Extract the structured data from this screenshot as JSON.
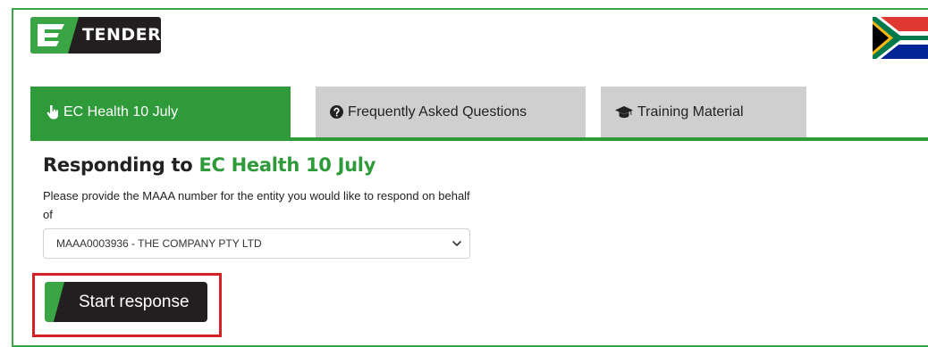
{
  "logo": {
    "text": "TENDER"
  },
  "tabs": [
    {
      "label": "EC Health 10 July",
      "icon": "hand-pointer-icon",
      "active": true
    },
    {
      "label": "Frequently Asked Questions",
      "icon": "question-circle-icon",
      "active": false
    },
    {
      "label": "Training Material",
      "icon": "graduation-cap-icon",
      "active": false
    }
  ],
  "heading": {
    "prefix": "Responding to",
    "tender_name": "EC Health 10 July"
  },
  "instructions": "Please provide the MAAA number for the entity you would like to respond on behalf of",
  "entity_select": {
    "selected": "MAAA0003936 - THE COMPANY PTY LTD"
  },
  "start_button": {
    "label": "Start response"
  },
  "colors": {
    "brand_green": "#2f9a3a",
    "logo_dark": "#231f20",
    "tab_inactive": "#cfcfcf",
    "highlight_red": "#d42027"
  }
}
